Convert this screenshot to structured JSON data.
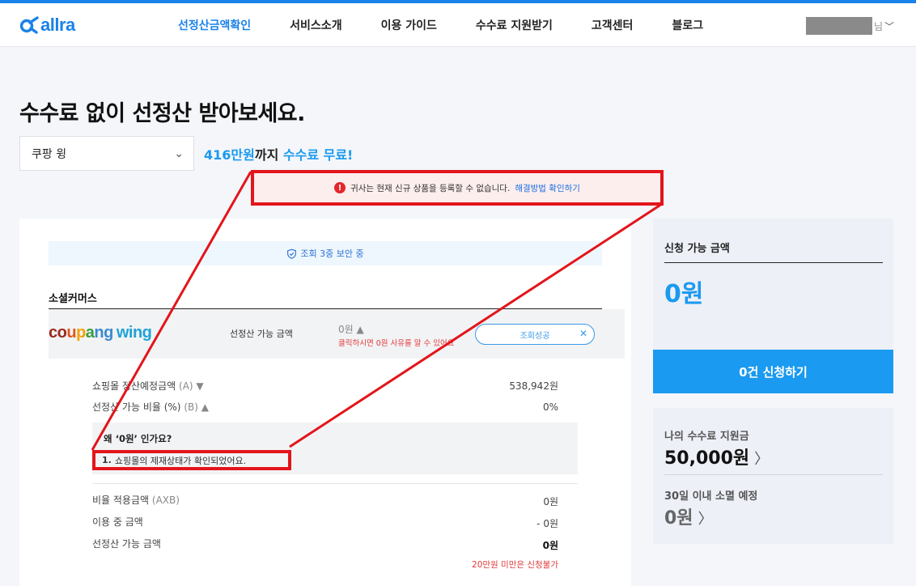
{
  "header": {
    "logo_text": "allra",
    "nav": [
      {
        "label": "선정산금액확인",
        "active": true
      },
      {
        "label": "서비스소개",
        "active": false
      },
      {
        "label": "이용 가이드",
        "active": false
      },
      {
        "label": "수수료 지원받기",
        "active": false
      },
      {
        "label": "고객센터",
        "active": false
      },
      {
        "label": "블로그",
        "active": false
      }
    ],
    "user_suffix": "님",
    "user_chevron": "﹀"
  },
  "headline": "수수료 없이 선정산 받아보세요.",
  "store_select": {
    "value": "쿠팡 윙",
    "chevron": "⌄"
  },
  "promo": {
    "amount": "416만원",
    "middle": "까지",
    "free": "수수료 무료!"
  },
  "alert": {
    "icon": "!",
    "message": "귀사는 현재 신규 상품을 등록할 수 없습니다.",
    "link": "해결방법 확인하기"
  },
  "security_text": "조회 3중 보안 중",
  "section_title": "소셜커머스",
  "coupang_row": {
    "logo_letters": [
      "c",
      "o",
      "u",
      "p",
      "a",
      "n",
      "g"
    ],
    "logo_wing": "wing",
    "label": "선정산 가능 금액",
    "amount": "0원 ▲",
    "note": "클릭하시면 0원 사유를 알 수 있어요",
    "status": "조회성공",
    "close": "✕"
  },
  "details": {
    "expected_label": "쇼핑몰 정산예정금액",
    "expected_code": "(A) ▼",
    "expected_value": "538,942원",
    "ratio_label": "선정산 가능 비율 (%)",
    "ratio_code": "(B) ▲",
    "ratio_value": "0%",
    "reason_title": "왜 ‘0원’ 인가요?",
    "reason_num": "1.",
    "reason_text": "쇼핑몰의 제재상태가 확인되었어요.",
    "applied_label": "비율 적용금액",
    "applied_code": "(AXB)",
    "applied_value": "0원",
    "in_use_label": "이용 중 금액",
    "in_use_value": "- 0원",
    "available_label": "선정산 가능 금액",
    "available_value": "0원",
    "min_note": "20만원 미만은 신청불가"
  },
  "side": {
    "title": "신청 가능 금액",
    "amount": "0원",
    "apply_button": "0건 신청하기",
    "fee_support_label": "나의 수수료 지원금",
    "fee_support_amount": "50,000원",
    "expire_label": "30일 이내 소멸 예정",
    "expire_amount": "0원",
    "arrow": "〉"
  },
  "colors": {
    "accent": "#1a9af0",
    "brand": "#1a82e8",
    "alert_red": "#e2151b"
  }
}
